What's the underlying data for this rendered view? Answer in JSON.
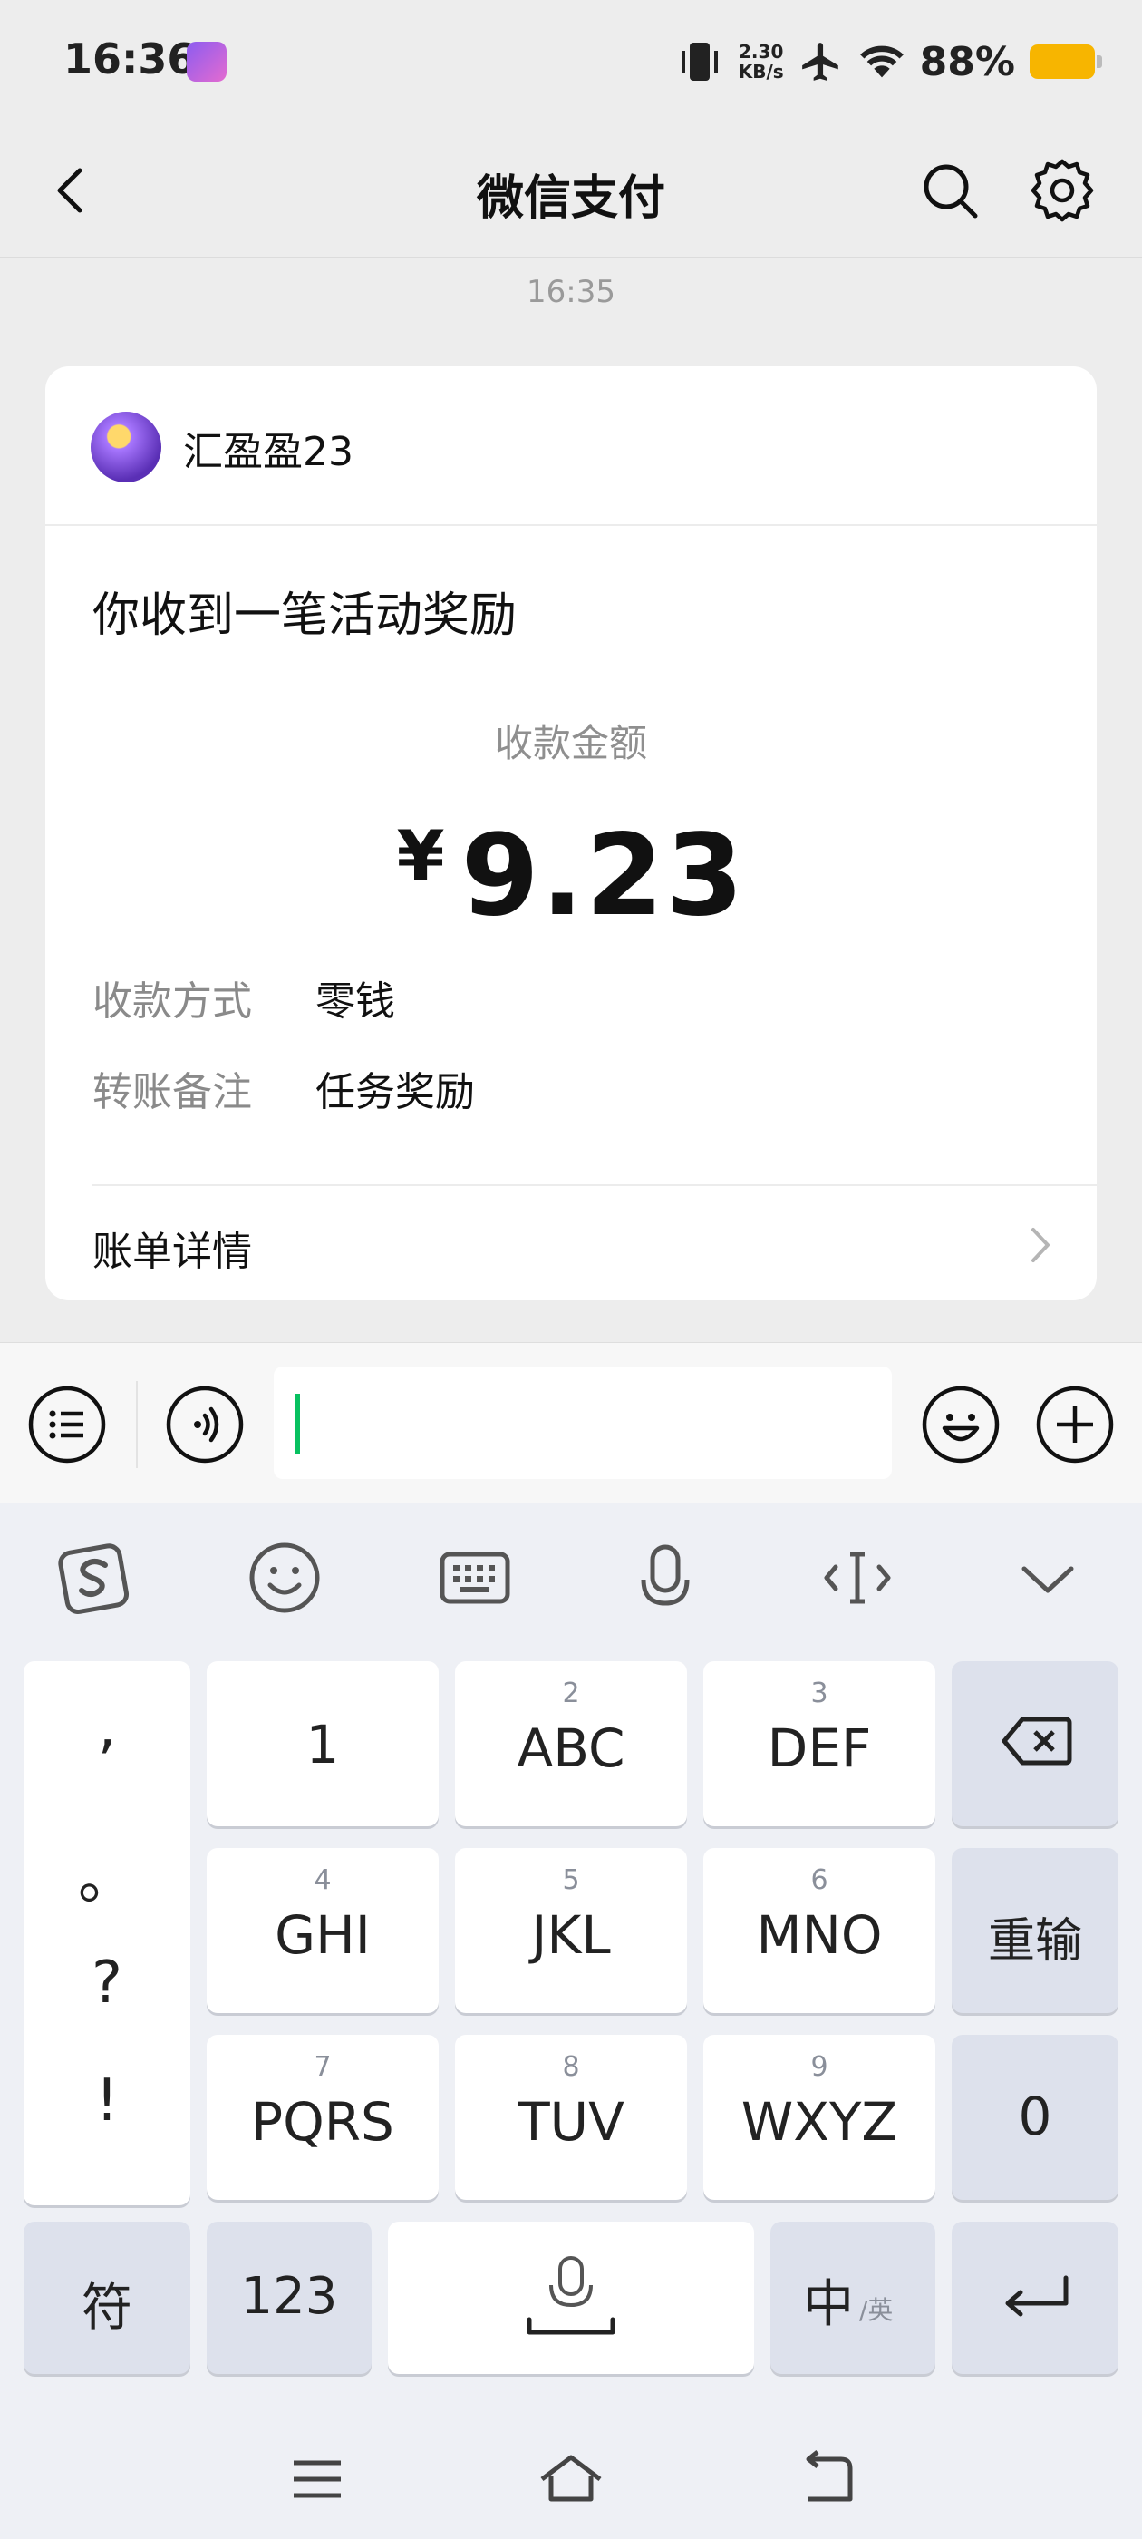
{
  "status_bar": {
    "time": "16:36",
    "net_speed_value": "2.30",
    "net_speed_unit": "KB/s",
    "battery": "88%"
  },
  "header": {
    "title": "微信支付"
  },
  "message_time": "16:35",
  "card": {
    "sender": "汇盈盈23",
    "title": "你收到一笔活动奖励",
    "amount_label": "收款金额",
    "currency": "¥",
    "amount": "9.23",
    "rows": [
      {
        "key": "收款方式",
        "value": "零钱"
      },
      {
        "key": "转账备注",
        "value": "任务奖励"
      }
    ],
    "bill_link": "账单详情"
  },
  "input_bar": {
    "value": ""
  },
  "keyboard": {
    "punctuation": [
      ",",
      "。",
      "?",
      "!"
    ],
    "keys": [
      {
        "num": "",
        "label": "1"
      },
      {
        "num": "2",
        "label": "ABC"
      },
      {
        "num": "3",
        "label": "DEF"
      },
      {
        "num": "4",
        "label": "GHI"
      },
      {
        "num": "5",
        "label": "JKL"
      },
      {
        "num": "6",
        "label": "MNO"
      },
      {
        "num": "7",
        "label": "PQRS"
      },
      {
        "num": "8",
        "label": "TUV"
      },
      {
        "num": "9",
        "label": "WXYZ"
      }
    ],
    "reset_label": "重输",
    "zero_label": "0",
    "symbol_label": "符",
    "numeric_label": "123",
    "lang_main": "中",
    "lang_alt": "/英"
  },
  "colors": {
    "accent": "#07c160",
    "battery": "#f7b500",
    "background": "#ededed"
  }
}
